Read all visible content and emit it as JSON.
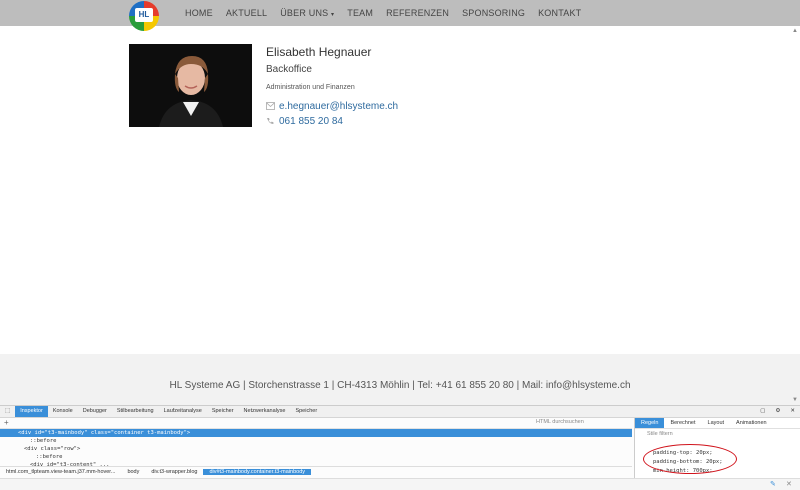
{
  "nav": {
    "items": [
      {
        "label": "HOME"
      },
      {
        "label": "AKTUELL"
      },
      {
        "label": "ÜBER UNS"
      },
      {
        "label": "TEAM"
      },
      {
        "label": "REFERENZEN"
      },
      {
        "label": "SPONSORING"
      },
      {
        "label": "KONTAKT"
      }
    ],
    "logo_text": "HL"
  },
  "person": {
    "name": "Elisabeth Hegnauer",
    "role": "Backoffice",
    "department": "Administration und Finanzen",
    "email": "e.hegnauer@hlsysteme.ch",
    "phone": "061 855 20 84"
  },
  "footer": {
    "text": "HL Systeme AG | Storchenstrasse 1 | CH-4313 Möhlin | Tel: +41 61 855 20 80 | Mail: info@hlsysteme.ch"
  },
  "devtools": {
    "tabs": [
      {
        "label": "Inspektor"
      },
      {
        "label": "Konsole"
      },
      {
        "label": "Debugger"
      },
      {
        "label": "Stilbearbeitung"
      },
      {
        "label": "Laufzeitanalyse"
      },
      {
        "label": "Speicher"
      },
      {
        "label": "Netzwerkanalyse"
      },
      {
        "label": "Speicher"
      }
    ],
    "search_placeholder": "HTML durchsuchen",
    "code_lines": [
      "<div id=\"t3-mainbody\" class=\"container t3-mainbody\">",
      "::before",
      "<div class=\"row\">",
      "::before",
      "<div id=\"t3-content\" ..."
    ],
    "breadcrumbs": [
      {
        "label": "html.com_tlpteam.view-team.j37.mm-hover..."
      },
      {
        "label": "body"
      },
      {
        "label": "div.t3-wrapper.blog"
      },
      {
        "label": "div#t3-mainbody.container.t3-mainbody"
      }
    ],
    "rules_tabs": [
      {
        "label": "Regeln"
      },
      {
        "label": "Berechnet"
      },
      {
        "label": "Layout"
      },
      {
        "label": "Animationen"
      }
    ],
    "rules_filter_placeholder": "Stile filtern",
    "rule_lines": [
      "padding-top: 20px;",
      "padding-bottom: 20px;",
      "min-height: 700px;"
    ]
  }
}
